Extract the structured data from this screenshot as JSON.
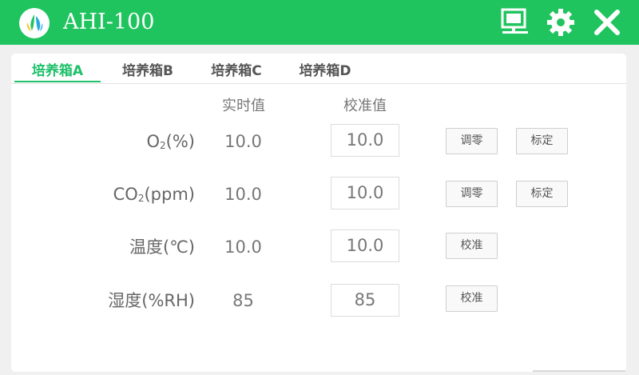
{
  "app": {
    "title": "AHI-100"
  },
  "toolbar": {
    "icons": [
      "monitor-icon",
      "gear-icon",
      "close-icon"
    ],
    "color": "#ffffff"
  },
  "colors": {
    "titlebar": "#20c45e",
    "active_tab": "#1ec06a"
  },
  "tabs": [
    {
      "label": "培养箱A",
      "active": true
    },
    {
      "label": "培养箱B",
      "active": false
    },
    {
      "label": "培养箱C",
      "active": false
    },
    {
      "label": "培养箱D",
      "active": false
    }
  ],
  "columns": {
    "realtime": "实时值",
    "calibrated": "校准值"
  },
  "rows": [
    {
      "label_main": "O",
      "label_sub": "2",
      "label_tail": "(%)",
      "realtime": "10.0",
      "calibrated": "10.0",
      "actions": [
        "调零",
        "标定"
      ]
    },
    {
      "label_main": "CO",
      "label_sub": "2",
      "label_tail": "(ppm)",
      "realtime": "10.0",
      "calibrated": "10.0",
      "actions": [
        "调零",
        "标定"
      ]
    },
    {
      "label_main": "温度(℃)",
      "label_sub": "",
      "label_tail": "",
      "realtime": "10.0",
      "calibrated": "10.0",
      "actions": [
        "校准"
      ]
    },
    {
      "label_main": "湿度(%RH)",
      "label_sub": "",
      "label_tail": "",
      "realtime": "85",
      "calibrated": "85",
      "actions": [
        "校准"
      ]
    }
  ]
}
